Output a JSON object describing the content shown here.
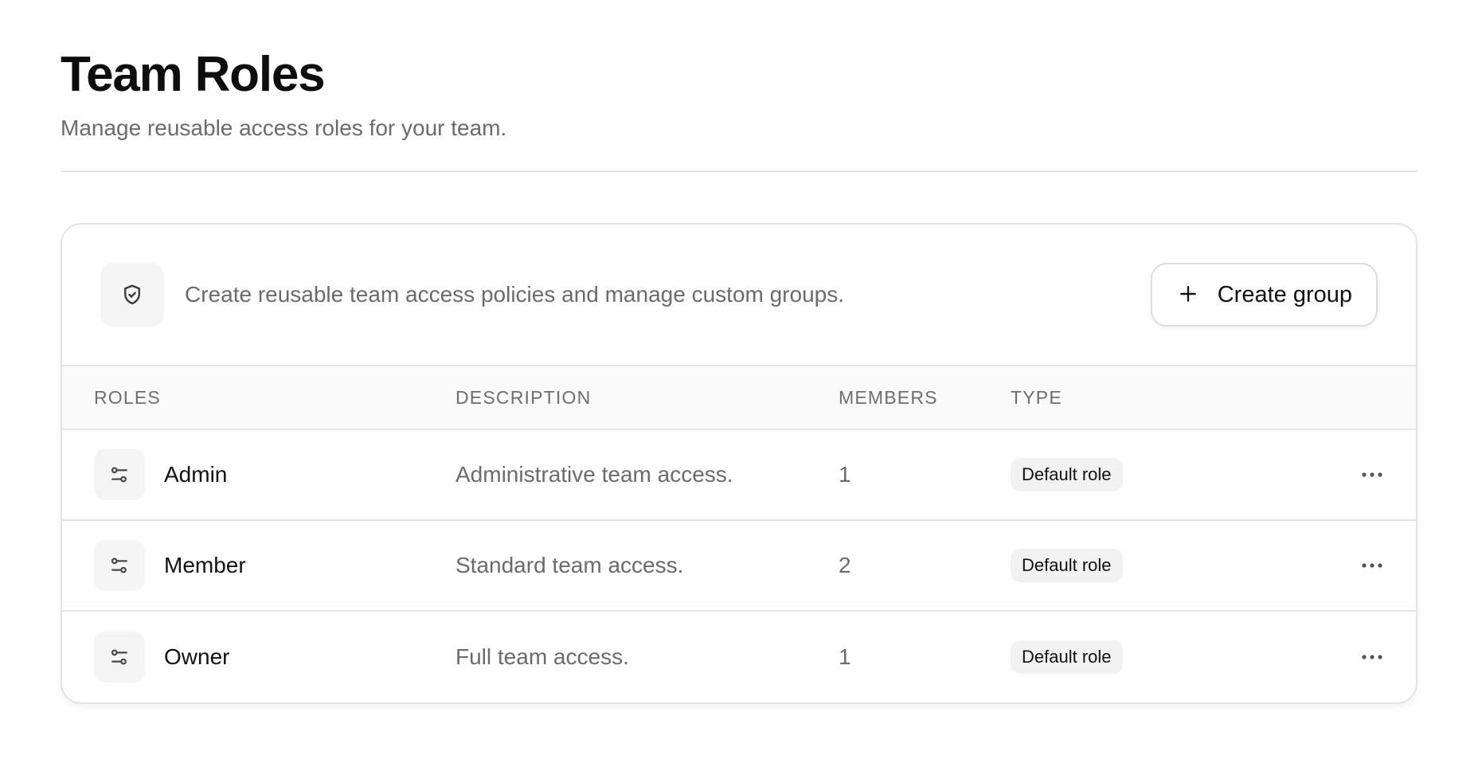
{
  "header": {
    "title": "Team Roles",
    "subtitle": "Manage reusable access roles for your team."
  },
  "card": {
    "intro_icon": "shield-check-icon",
    "intro_text": "Create reusable team access policies and manage custom groups.",
    "create_button": {
      "icon": "plus-icon",
      "label": "Create group"
    }
  },
  "table": {
    "columns": {
      "roles": "ROLES",
      "description": "DESCRIPTION",
      "members": "MEMBERS",
      "type": "TYPE"
    },
    "rows": [
      {
        "icon": "sliders-icon",
        "role": "Admin",
        "description": "Administrative team access.",
        "members": "1",
        "type": "Default role",
        "actions_icon": "more-horizontal-icon"
      },
      {
        "icon": "sliders-icon",
        "role": "Member",
        "description": "Standard team access.",
        "members": "2",
        "type": "Default role",
        "actions_icon": "more-horizontal-icon"
      },
      {
        "icon": "sliders-icon",
        "role": "Owner",
        "description": "Full team access.",
        "members": "1",
        "type": "Default role",
        "actions_icon": "more-horizontal-icon"
      }
    ]
  },
  "colors": {
    "text_primary": "#111111",
    "text_muted": "#6b6b6b",
    "border": "#e6e6e6",
    "icon_bg": "#f5f5f5",
    "header_bg": "#fafafa"
  }
}
